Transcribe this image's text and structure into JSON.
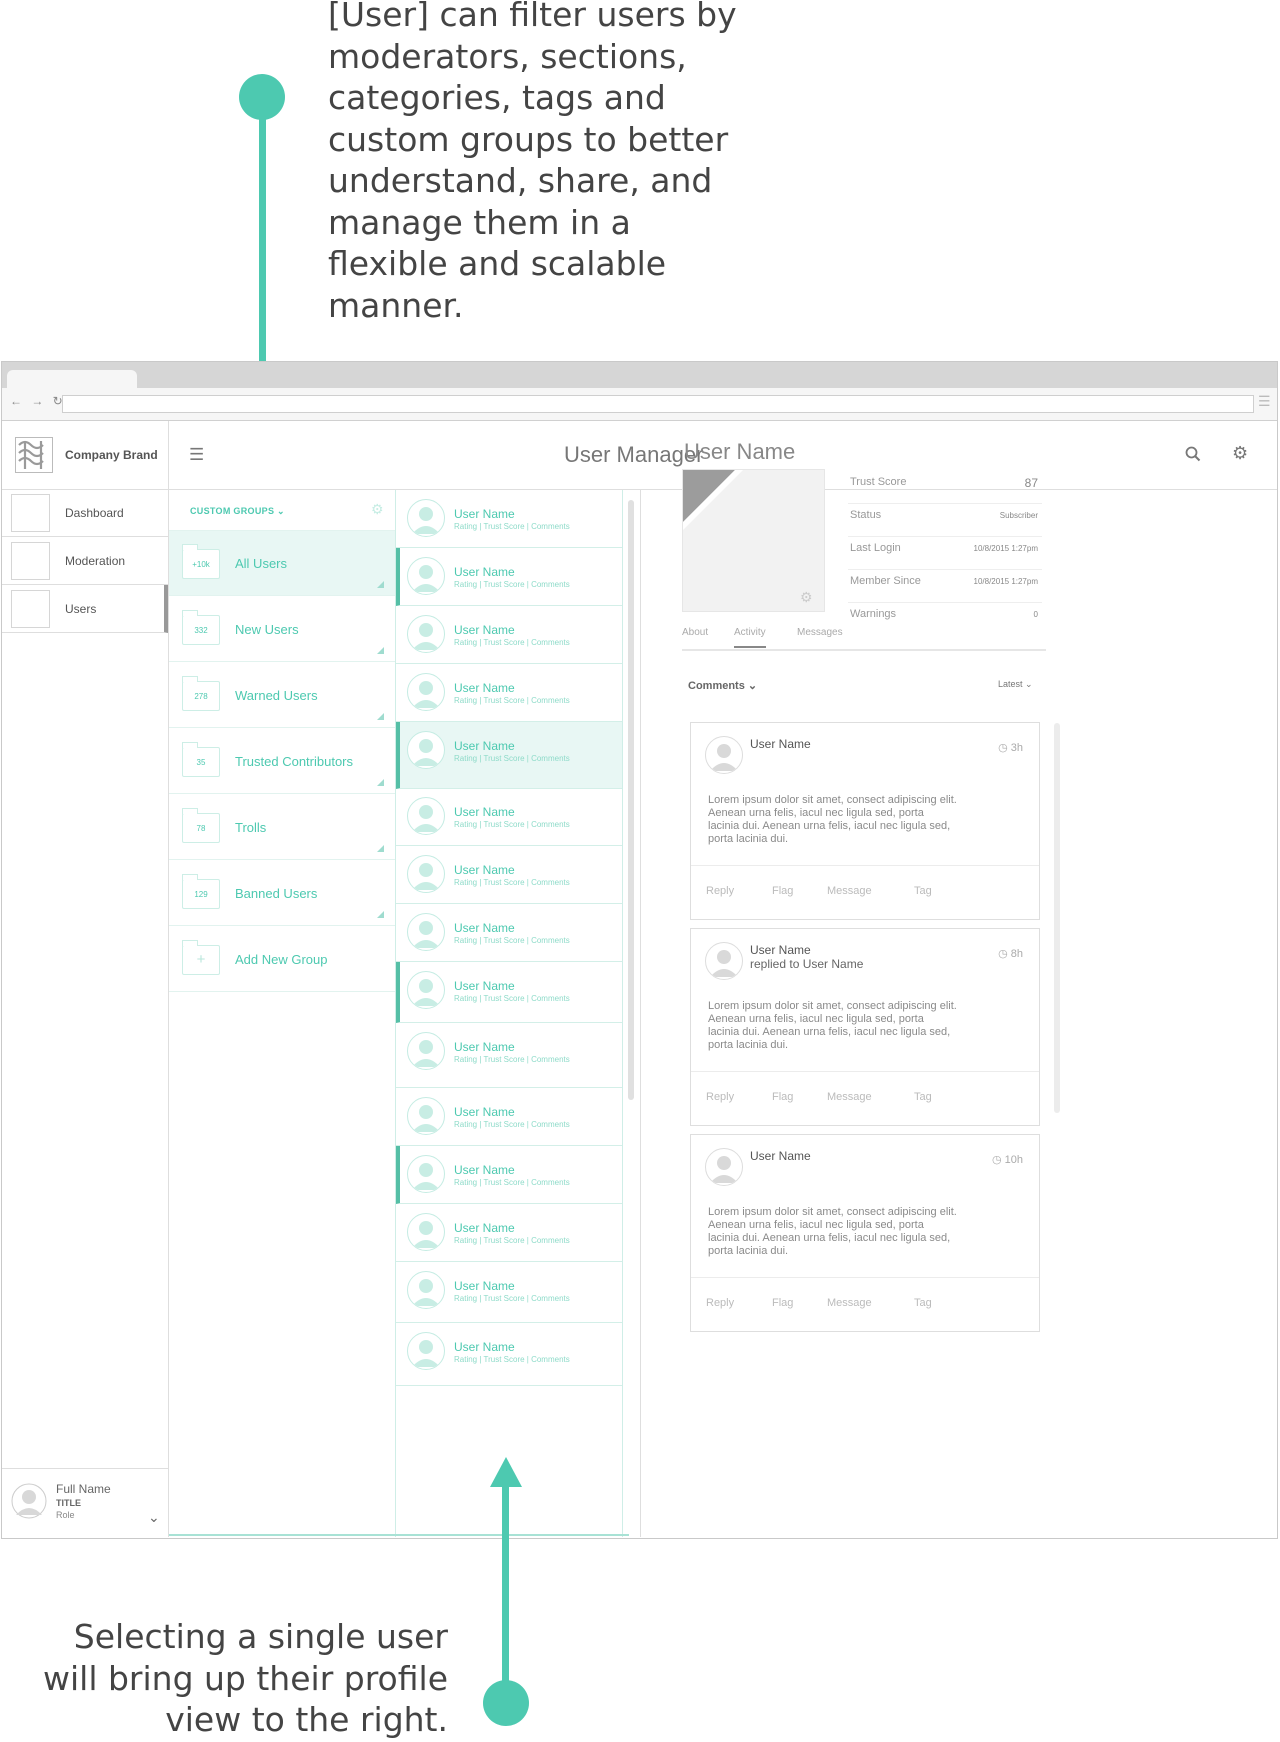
{
  "annotations": {
    "top": "[User] can filter users by moderators, sections, categories, tags and custom groups to better understand, share, and manage them in a flexible and scalable manner.",
    "bottom_line1": "Selecting a single user",
    "bottom_line2": "will bring up their profile",
    "bottom_line3": "view to the right."
  },
  "browser": {
    "nav_icons": "← → ↻",
    "menu_icon": "menu-icon"
  },
  "sidebar": {
    "brand": "Company Brand",
    "items": [
      {
        "label": "Dashboard"
      },
      {
        "label": "Moderation"
      },
      {
        "label": "Users",
        "selected": true
      }
    ],
    "user": {
      "name": "Full Name",
      "title": "TITLE",
      "role": "Role"
    }
  },
  "header": {
    "title": "User Manager",
    "menu_icon": "hamburger-icon",
    "search_icon": "search-icon",
    "settings_icon": "gear-icon"
  },
  "groups": {
    "heading": "CUSTOM GROUPS",
    "items": [
      {
        "count": "+10k",
        "name": "All Users",
        "selected": true
      },
      {
        "count": "332",
        "name": "New Users"
      },
      {
        "count": "278",
        "name": "Warned Users"
      },
      {
        "count": "35",
        "name": "Trusted Contributors"
      },
      {
        "count": "78",
        "name": "Trolls"
      },
      {
        "count": "129",
        "name": "Banned Users"
      }
    ],
    "add_label": "Add New Group"
  },
  "users": {
    "name": "User Name",
    "meta": "Rating | Trust Score | Comments"
  },
  "profile": {
    "name": "User Name",
    "stats": [
      {
        "label": "Trust Score",
        "value": "87"
      },
      {
        "label": "Status",
        "value": "Subscriber"
      },
      {
        "label": "Last Login",
        "value": "10/8/2015  1:27pm"
      },
      {
        "label": "Member Since",
        "value": "10/8/2015  1:27pm"
      },
      {
        "label": "Warnings",
        "value": "0"
      }
    ],
    "tabs": [
      "About",
      "Activity",
      "Messages"
    ],
    "active_tab": "Activity",
    "comments_label": "Comments",
    "sort_label": "Latest",
    "comments": [
      {
        "name": "User Name",
        "reply": "",
        "time": "3h",
        "body": "Lorem ipsum dolor sit amet, consect adipiscing elit. Aenean urna felis, iacul nec ligula sed, porta lacinia dui. Aenean urna felis, iacul nec ligula sed, porta lacinia dui."
      },
      {
        "name": "User Name",
        "reply": "replied to User Name",
        "time": "8h",
        "body": "Lorem ipsum dolor sit amet, consect adipiscing elit. Aenean urna felis, iacul nec ligula sed, porta lacinia dui. Aenean urna felis, iacul nec ligula sed, porta lacinia dui."
      },
      {
        "name": "User Name",
        "reply": "",
        "time": "10h",
        "body": "Lorem ipsum dolor sit amet, consect adipiscing elit. Aenean urna felis, iacul nec ligula sed, porta lacinia dui. Aenean urna felis, iacul nec ligula sed, porta lacinia dui."
      }
    ],
    "actions": [
      "Reply",
      "Flag",
      "Message",
      "Tag"
    ]
  },
  "colors": {
    "accent": "#4dc9b0",
    "selected_bg": "#e8f7f4"
  }
}
